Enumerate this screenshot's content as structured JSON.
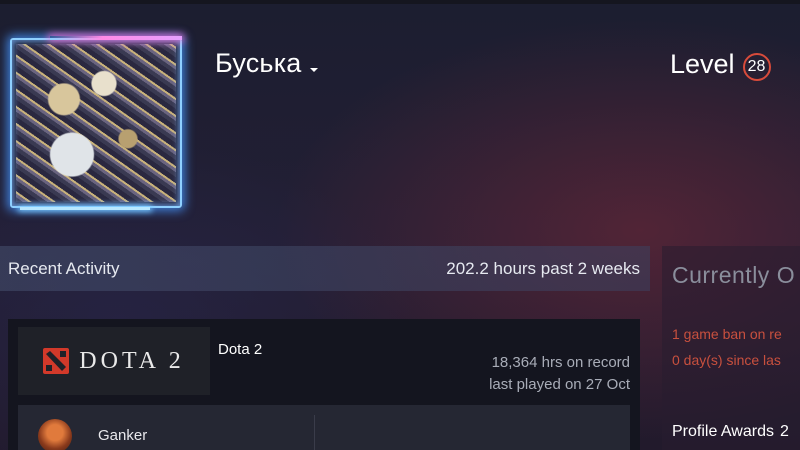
{
  "profile": {
    "name": "Буська",
    "level_label": "Level",
    "level_value": "28"
  },
  "activity": {
    "title": "Recent Activity",
    "hours": "202.2 hours past 2 weeks"
  },
  "game": {
    "capsule_wordmark": "DOTA 2",
    "name": "Dota 2",
    "hours_on_record": "18,364 hrs on record",
    "last_played": "last played on 27 Oct",
    "hero_name": "Ganker"
  },
  "side_panel": {
    "title": "Currently O",
    "ban_line_1": "1 game ban on re",
    "ban_line_2": "0 day(s) since las",
    "awards_label": "Profile Awards",
    "awards_count": "2"
  },
  "colors": {
    "ban_red": "#c8503e",
    "level_ring": "#d84b3b",
    "avatar_glow": "#8fd0ff"
  }
}
